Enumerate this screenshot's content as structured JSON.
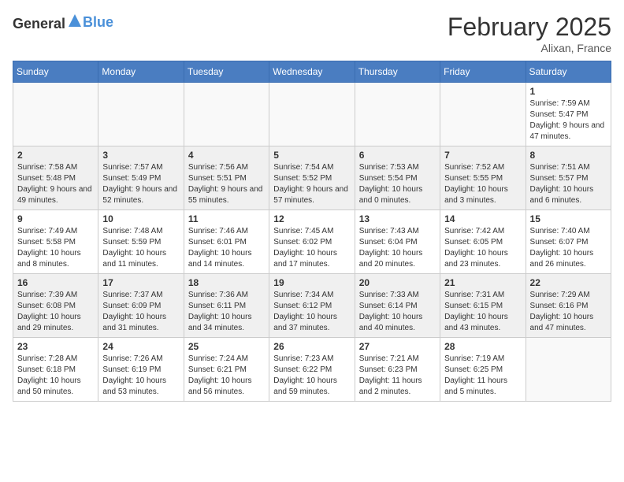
{
  "header": {
    "logo_general": "General",
    "logo_blue": "Blue",
    "month": "February 2025",
    "location": "Alixan, France"
  },
  "weekdays": [
    "Sunday",
    "Monday",
    "Tuesday",
    "Wednesday",
    "Thursday",
    "Friday",
    "Saturday"
  ],
  "weeks": [
    {
      "shaded": false,
      "days": [
        {
          "num": "",
          "info": ""
        },
        {
          "num": "",
          "info": ""
        },
        {
          "num": "",
          "info": ""
        },
        {
          "num": "",
          "info": ""
        },
        {
          "num": "",
          "info": ""
        },
        {
          "num": "",
          "info": ""
        },
        {
          "num": "1",
          "info": "Sunrise: 7:59 AM\nSunset: 5:47 PM\nDaylight: 9 hours and 47 minutes."
        }
      ]
    },
    {
      "shaded": true,
      "days": [
        {
          "num": "2",
          "info": "Sunrise: 7:58 AM\nSunset: 5:48 PM\nDaylight: 9 hours and 49 minutes."
        },
        {
          "num": "3",
          "info": "Sunrise: 7:57 AM\nSunset: 5:49 PM\nDaylight: 9 hours and 52 minutes."
        },
        {
          "num": "4",
          "info": "Sunrise: 7:56 AM\nSunset: 5:51 PM\nDaylight: 9 hours and 55 minutes."
        },
        {
          "num": "5",
          "info": "Sunrise: 7:54 AM\nSunset: 5:52 PM\nDaylight: 9 hours and 57 minutes."
        },
        {
          "num": "6",
          "info": "Sunrise: 7:53 AM\nSunset: 5:54 PM\nDaylight: 10 hours and 0 minutes."
        },
        {
          "num": "7",
          "info": "Sunrise: 7:52 AM\nSunset: 5:55 PM\nDaylight: 10 hours and 3 minutes."
        },
        {
          "num": "8",
          "info": "Sunrise: 7:51 AM\nSunset: 5:57 PM\nDaylight: 10 hours and 6 minutes."
        }
      ]
    },
    {
      "shaded": false,
      "days": [
        {
          "num": "9",
          "info": "Sunrise: 7:49 AM\nSunset: 5:58 PM\nDaylight: 10 hours and 8 minutes."
        },
        {
          "num": "10",
          "info": "Sunrise: 7:48 AM\nSunset: 5:59 PM\nDaylight: 10 hours and 11 minutes."
        },
        {
          "num": "11",
          "info": "Sunrise: 7:46 AM\nSunset: 6:01 PM\nDaylight: 10 hours and 14 minutes."
        },
        {
          "num": "12",
          "info": "Sunrise: 7:45 AM\nSunset: 6:02 PM\nDaylight: 10 hours and 17 minutes."
        },
        {
          "num": "13",
          "info": "Sunrise: 7:43 AM\nSunset: 6:04 PM\nDaylight: 10 hours and 20 minutes."
        },
        {
          "num": "14",
          "info": "Sunrise: 7:42 AM\nSunset: 6:05 PM\nDaylight: 10 hours and 23 minutes."
        },
        {
          "num": "15",
          "info": "Sunrise: 7:40 AM\nSunset: 6:07 PM\nDaylight: 10 hours and 26 minutes."
        }
      ]
    },
    {
      "shaded": true,
      "days": [
        {
          "num": "16",
          "info": "Sunrise: 7:39 AM\nSunset: 6:08 PM\nDaylight: 10 hours and 29 minutes."
        },
        {
          "num": "17",
          "info": "Sunrise: 7:37 AM\nSunset: 6:09 PM\nDaylight: 10 hours and 31 minutes."
        },
        {
          "num": "18",
          "info": "Sunrise: 7:36 AM\nSunset: 6:11 PM\nDaylight: 10 hours and 34 minutes."
        },
        {
          "num": "19",
          "info": "Sunrise: 7:34 AM\nSunset: 6:12 PM\nDaylight: 10 hours and 37 minutes."
        },
        {
          "num": "20",
          "info": "Sunrise: 7:33 AM\nSunset: 6:14 PM\nDaylight: 10 hours and 40 minutes."
        },
        {
          "num": "21",
          "info": "Sunrise: 7:31 AM\nSunset: 6:15 PM\nDaylight: 10 hours and 43 minutes."
        },
        {
          "num": "22",
          "info": "Sunrise: 7:29 AM\nSunset: 6:16 PM\nDaylight: 10 hours and 47 minutes."
        }
      ]
    },
    {
      "shaded": false,
      "days": [
        {
          "num": "23",
          "info": "Sunrise: 7:28 AM\nSunset: 6:18 PM\nDaylight: 10 hours and 50 minutes."
        },
        {
          "num": "24",
          "info": "Sunrise: 7:26 AM\nSunset: 6:19 PM\nDaylight: 10 hours and 53 minutes."
        },
        {
          "num": "25",
          "info": "Sunrise: 7:24 AM\nSunset: 6:21 PM\nDaylight: 10 hours and 56 minutes."
        },
        {
          "num": "26",
          "info": "Sunrise: 7:23 AM\nSunset: 6:22 PM\nDaylight: 10 hours and 59 minutes."
        },
        {
          "num": "27",
          "info": "Sunrise: 7:21 AM\nSunset: 6:23 PM\nDaylight: 11 hours and 2 minutes."
        },
        {
          "num": "28",
          "info": "Sunrise: 7:19 AM\nSunset: 6:25 PM\nDaylight: 11 hours and 5 minutes."
        },
        {
          "num": "",
          "info": ""
        }
      ]
    }
  ]
}
